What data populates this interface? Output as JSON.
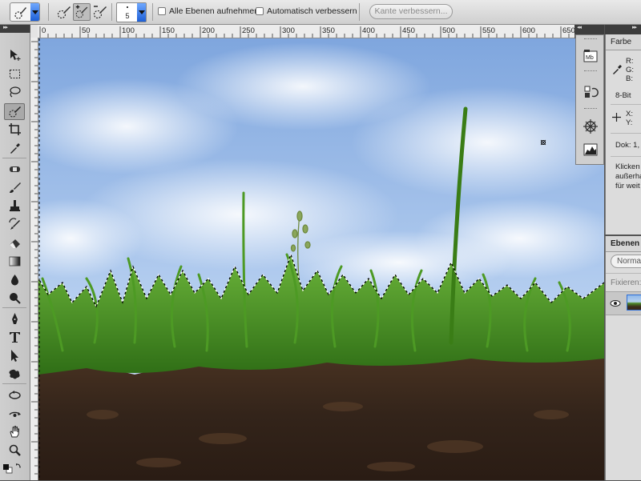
{
  "options_bar": {
    "brush_size": "5",
    "sample_all_layers_label": "Alle Ebenen aufnehmen",
    "auto_enhance_label": "Automatisch verbessern",
    "refine_edge_label": "Kante verbessern..."
  },
  "ruler": {
    "ticks": [
      "0",
      "50",
      "100",
      "150",
      "200",
      "250",
      "300",
      "350",
      "400",
      "450",
      "500",
      "550",
      "600",
      "650"
    ]
  },
  "tools": [
    "move-tool",
    "rectangular-marquee-tool",
    "lasso-tool",
    "quick-selection-tool",
    "crop-tool",
    "eyedropper-tool",
    "spot-healing-brush-tool",
    "brush-tool",
    "clone-stamp-tool",
    "history-brush-tool",
    "eraser-tool",
    "gradient-tool",
    "blur-tool",
    "dodge-tool",
    "pen-tool",
    "type-tool",
    "path-selection-tool",
    "custom-shape-tool",
    "3d-rotate-tool",
    "3d-orbit-tool",
    "hand-tool",
    "zoom-tool"
  ],
  "active_tool": "quick-selection-tool",
  "info_panel": {
    "tab": "Farbe",
    "r": "R:",
    "g": "G:",
    "b": "B:",
    "bit_depth": "8-Bit",
    "x": "X:",
    "y": "Y:",
    "doc": "Dok: 1,",
    "hint_line1": "Klicken",
    "hint_line2": "außerha",
    "hint_line3": "für weit"
  },
  "layers_panel": {
    "tab": "Ebenen",
    "blend_mode": "Norma",
    "lock_label": "Fixieren:"
  },
  "colors": {
    "selection_highlight": "#1d5fd6",
    "sky": "#a9c6ea",
    "grass": "#3f8a1f",
    "soil": "#3a2a1e"
  }
}
